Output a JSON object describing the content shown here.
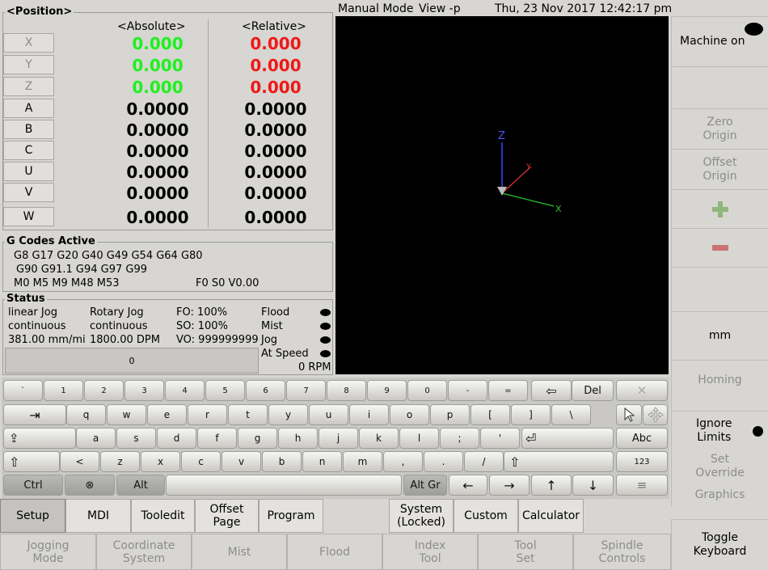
{
  "position": {
    "title": "<Position>",
    "abs_header": "<Absolute>",
    "rel_header": "<Relative>",
    "axes": [
      {
        "name": "X",
        "abs": "0.000",
        "rel": "0.000",
        "enabled": false
      },
      {
        "name": "Y",
        "abs": "0.000",
        "rel": "0.000",
        "enabled": false
      },
      {
        "name": "Z",
        "abs": "0.000",
        "rel": "0.000",
        "enabled": false
      },
      {
        "name": "A",
        "abs": "0.0000",
        "rel": "0.0000",
        "enabled": true
      },
      {
        "name": "B",
        "abs": "0.0000",
        "rel": "0.0000",
        "enabled": true
      },
      {
        "name": "C",
        "abs": "0.0000",
        "rel": "0.0000",
        "enabled": true
      },
      {
        "name": "U",
        "abs": "0.0000",
        "rel": "0.0000",
        "enabled": true
      },
      {
        "name": "V",
        "abs": "0.0000",
        "rel": "0.0000",
        "enabled": true
      },
      {
        "name": "W",
        "abs": "0.0000",
        "rel": "0.0000",
        "enabled": true
      }
    ]
  },
  "gcodes": {
    "title": "G Codes Active",
    "line1": "G8 G17 G20 G40 G49 G54 G64 G80",
    "line2": "G90 G91.1 G94 G97 G99",
    "line3": "M0 M5 M9 M48 M53",
    "feed_speed": "F0   S0   V0.00"
  },
  "status": {
    "title": "Status",
    "linear_jog": "linear Jog",
    "linear_mode": "continuous",
    "linear_rate": "381.00 mm/mi",
    "rotary_jog": "Rotary Jog",
    "rotary_mode": "continuous",
    "rotary_rate": "1800.00 DPM",
    "fo": "FO: 100%",
    "so": "SO: 100%",
    "vo": "VO: 999999999",
    "flood": "Flood",
    "mist": "Mist",
    "jog": "Jog",
    "at_speed": "At Speed",
    "progress_text": "0",
    "rpm": "0 RPM"
  },
  "header": {
    "mode": "Manual Mode",
    "view": "View -p",
    "datetime": "Thu, 23 Nov 2017  12:42:17 pm"
  },
  "view3d": {
    "z": "Z",
    "x": "X",
    "y": "Y"
  },
  "side": {
    "machine_on": "Machine on",
    "zero_origin": "Zero\nOrigin",
    "offset_origin": "Offset\nOrigin",
    "units": "mm",
    "homing": "Homing",
    "ignore_limits": "Ignore\nLimits",
    "set_override": "Set\nOverride",
    "graphics": "Graphics",
    "toggle_keyboard": "Toggle\nKeyboard"
  },
  "keyboard": {
    "row1": [
      "`",
      "1",
      "2",
      "3",
      "4",
      "5",
      "6",
      "7",
      "8",
      "9",
      "0",
      "-",
      "="
    ],
    "backspace": "⇦",
    "del": "Del",
    "close": "✕",
    "row2": [
      "q",
      "w",
      "e",
      "r",
      "t",
      "y",
      "u",
      "i",
      "o",
      "p",
      "[",
      "]",
      "\\"
    ],
    "tab": "⇥",
    "row3": [
      "a",
      "s",
      "d",
      "f",
      "g",
      "h",
      "j",
      "k",
      "l",
      ";",
      "'"
    ],
    "caps": "⇪",
    "enter": "⏎",
    "abc": "Abc",
    "row4": [
      "<",
      "z",
      "x",
      "c",
      "v",
      "b",
      "n",
      "m",
      ",",
      ".",
      "/"
    ],
    "shift_l": "⇧",
    "shift_r": "⇧",
    "num": "123",
    "ctrl": "Ctrl",
    "gear": "⊗",
    "alt": "Alt",
    "altgr": "Alt Gr",
    "left": "←",
    "right": "→",
    "up": "↑",
    "down": "↓",
    "menu": "≡"
  },
  "tabs": {
    "setup": "Setup",
    "mdi": "MDI",
    "tooledit": "Tooledit",
    "offset_page": "Offset\nPage",
    "program": "Program",
    "system": "System\n(Locked)",
    "custom": "Custom",
    "calculator": "Calculator"
  },
  "bottom": {
    "jogging_mode": "Jogging\nMode",
    "coordinate_system": "Coordinate\nSystem",
    "mist": "Mist",
    "flood": "Flood",
    "index_tool": "Index\nTool",
    "tool_set": "Tool\nSet",
    "spindle_controls": "Spindle\nControls"
  }
}
